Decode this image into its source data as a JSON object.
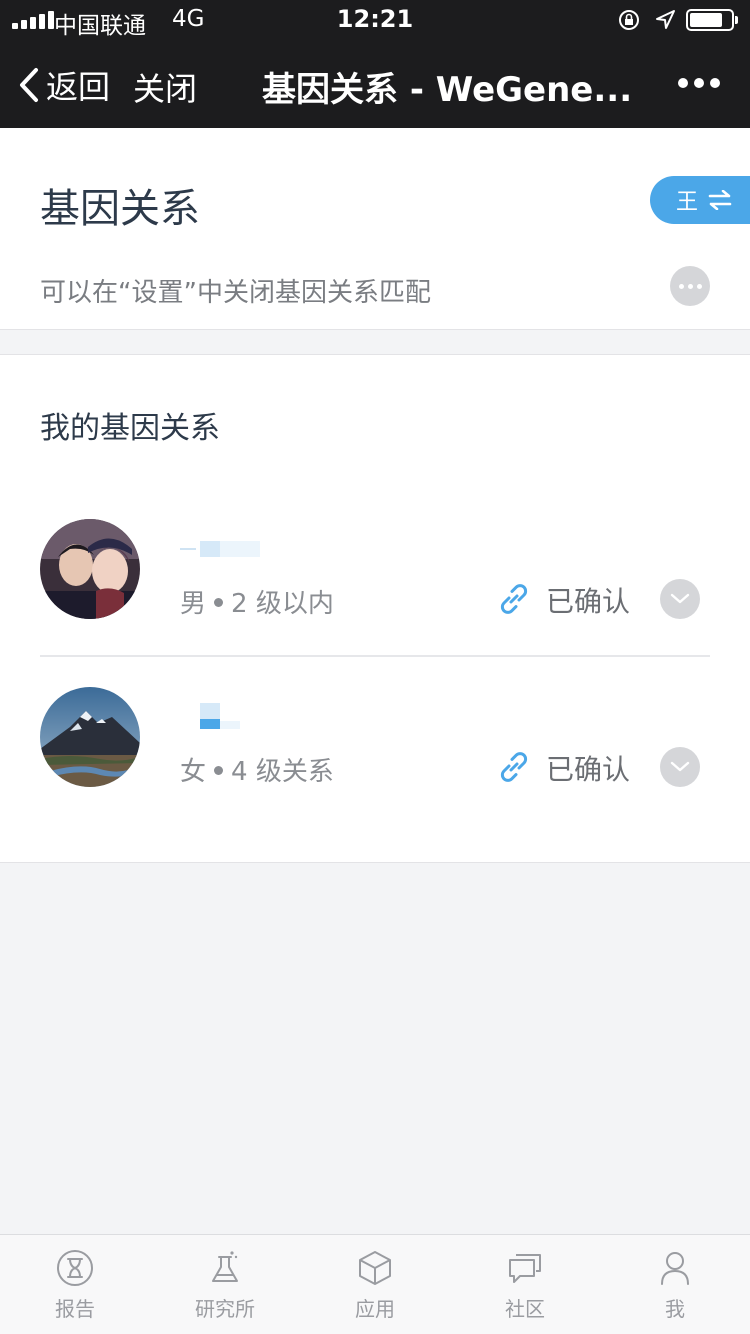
{
  "status_bar": {
    "carrier": "中国联通",
    "network": "4G",
    "time": "12:21"
  },
  "nav": {
    "back_label": "返回",
    "close_label": "关闭",
    "title": "基因关系 - WeGene..."
  },
  "header": {
    "title": "基因关系",
    "switch_label": "王",
    "subtitle": "可以在“设置”中关闭基因关系匹配"
  },
  "relations": {
    "section_title": "我的基因关系",
    "items": [
      {
        "gender": "男",
        "degree": "2 级以内",
        "status": "已确认"
      },
      {
        "gender": "女",
        "degree": "4 级关系",
        "status": "已确认"
      }
    ]
  },
  "tabbar": {
    "items": [
      {
        "label": "报告",
        "icon": "hourglass-icon"
      },
      {
        "label": "研究所",
        "icon": "flask-icon"
      },
      {
        "label": "应用",
        "icon": "cube-icon"
      },
      {
        "label": "社区",
        "icon": "chat-icon"
      },
      {
        "label": "我",
        "icon": "person-icon"
      }
    ]
  },
  "colors": {
    "accent": "#4ba7e8",
    "nav_bg": "#1c1c1e",
    "page_bg": "#f3f4f6"
  }
}
